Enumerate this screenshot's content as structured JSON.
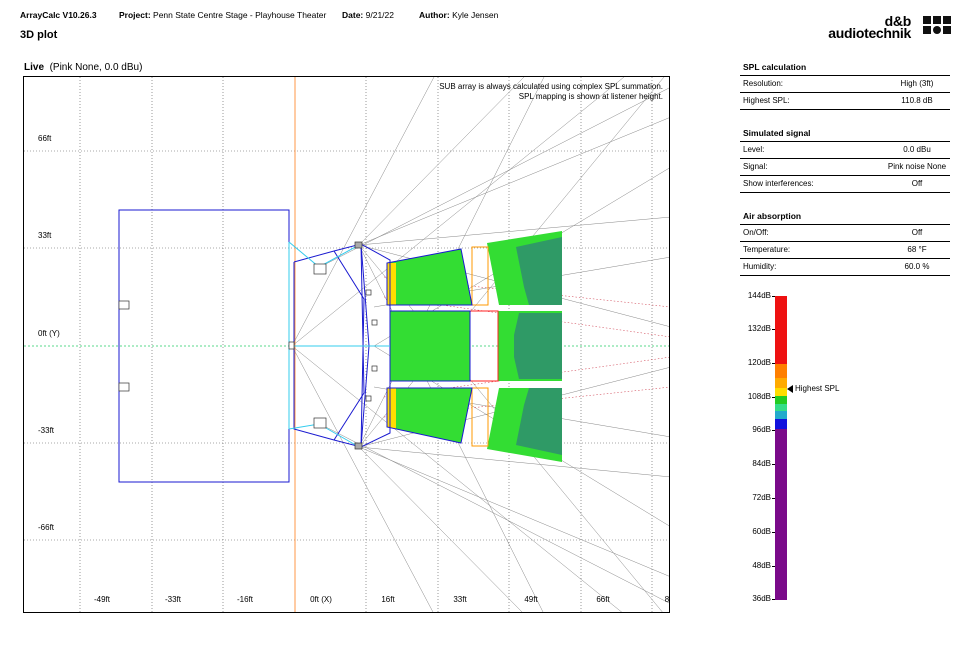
{
  "header": {
    "app": "ArrayCalc V10.26.3",
    "project_label": "Project:",
    "project": "Penn State Centre Stage - Playhouse Theater",
    "date_label": "Date:",
    "date": "9/21/22",
    "author_label": "Author:",
    "author": "Kyle Jensen",
    "page_title": "3D plot",
    "logo_line1": "d&b",
    "logo_line2": "audiotechnik"
  },
  "plot": {
    "mode": "Live",
    "subtitle": "(Pink None, 0.0 dBu)",
    "note1": "SUB array is always calculated using complex SPL summation.",
    "note2": "SPL mapping is shown at listener height.",
    "y_ticks": [
      "66ft",
      "33ft",
      "0ft (Y)",
      "-33ft",
      "-66ft"
    ],
    "x_ticks": [
      "-49ft",
      "-33ft",
      "-16ft",
      "0ft (X)",
      "16ft",
      "33ft",
      "49ft",
      "66ft",
      "8"
    ]
  },
  "spl_calculation": {
    "title": "SPL calculation",
    "rows": [
      {
        "label": "Resolution:",
        "value": "High (3ft)"
      },
      {
        "label": "Highest SPL:",
        "value": "110.8 dB"
      }
    ]
  },
  "simulated_signal": {
    "title": "Simulated signal",
    "rows": [
      {
        "label": "Level:",
        "value": "0.0 dBu"
      },
      {
        "label": "Signal:",
        "value": "Pink noise None"
      },
      {
        "label": "Show interferences:",
        "value": "Off"
      }
    ]
  },
  "air_absorption": {
    "title": "Air absorption",
    "rows": [
      {
        "label": "On/Off:",
        "value": "Off"
      },
      {
        "label": "Temperature:",
        "value": "68 °F"
      },
      {
        "label": "Humidity:",
        "value": "60.0 %"
      }
    ]
  },
  "scale": {
    "labels": [
      "144dB",
      "132dB",
      "120dB",
      "108dB",
      "96dB",
      "84dB",
      "72dB",
      "60dB",
      "48dB",
      "36dB"
    ],
    "highest_label": "Highest SPL",
    "colors": {
      "red": "#ee1111",
      "orange": "#ff7f00",
      "yellow": "#ffdd00",
      "green": "#22cc22",
      "teal": "#22aacc",
      "blue": "#1111dd",
      "purple": "#7a0a8a"
    }
  }
}
